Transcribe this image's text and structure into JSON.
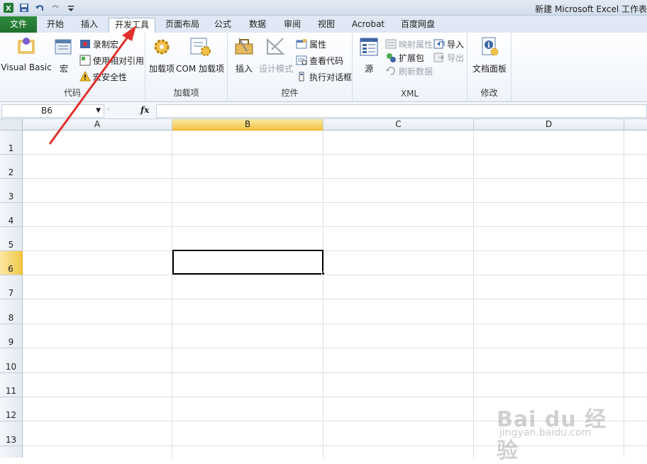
{
  "titlebar": {
    "title": "新建 Microsoft Excel 工作表"
  },
  "tabs": {
    "file": "文件",
    "items": [
      "开始",
      "插入",
      "开发工具",
      "页面布局",
      "公式",
      "数据",
      "审阅",
      "视图",
      "Acrobat",
      "百度网盘"
    ]
  },
  "ribbon": {
    "code": {
      "label": "代码",
      "visual_basic": "Visual Basic",
      "macros": "宏",
      "record_macro": "录制宏",
      "relative_ref": "使用相对引用",
      "macro_security": "宏安全性"
    },
    "addins": {
      "label": "加载项",
      "addins": "加载项",
      "com_addins": "COM 加载项"
    },
    "controls": {
      "label": "控件",
      "insert": "插入",
      "design_mode": "设计模式",
      "properties": "属性",
      "view_code": "查看代码",
      "run_dialog": "执行对话框"
    },
    "xml": {
      "label": "XML",
      "source": "源",
      "map_properties": "映射属性",
      "expansion_packs": "扩展包",
      "refresh_data": "刷新数据",
      "import": "导入",
      "export": "导出"
    },
    "modify": {
      "label": "修改",
      "document_panel": "文档面板"
    }
  },
  "formula_bar": {
    "name_box": "B6",
    "fx": "fx",
    "formula": ""
  },
  "sheet": {
    "columns": [
      "A",
      "B",
      "C",
      "D"
    ],
    "rows": [
      "1",
      "2",
      "3",
      "4",
      "5",
      "6",
      "7",
      "8",
      "9",
      "10",
      "11",
      "12",
      "13"
    ],
    "selected_cell": "B6"
  },
  "watermark": {
    "text": "Bai du 经验",
    "sub": "jingyan.baidu.com"
  }
}
